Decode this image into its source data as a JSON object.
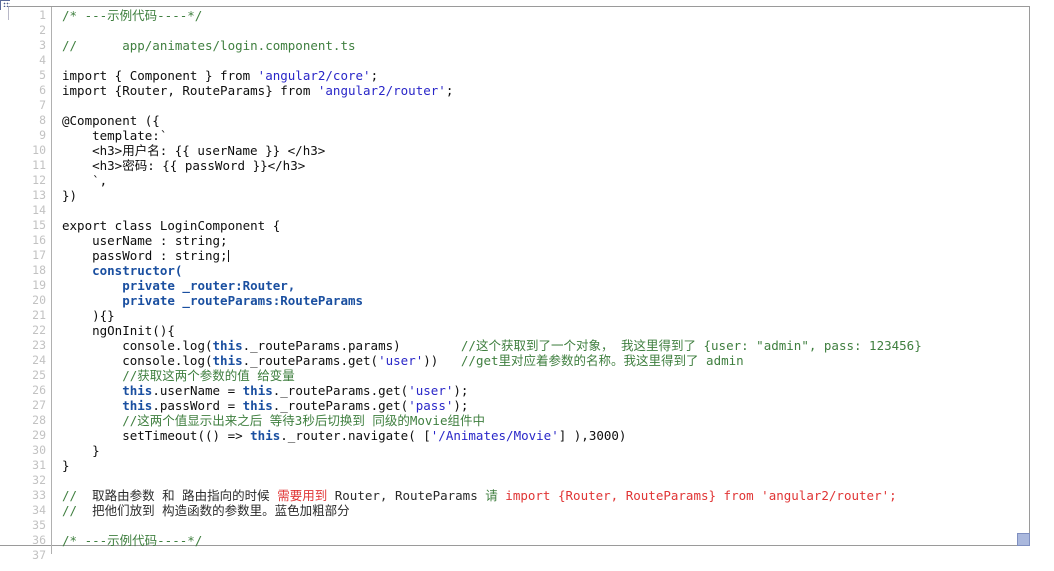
{
  "window": {
    "title": "Code editor",
    "total_lines": 37,
    "first_line": 1,
    "font_size_px": 12.5,
    "line_height_px": 15
  },
  "colors": {
    "background": "#ffffff",
    "gutter_text": "#c2c2c2",
    "gutter_separator": "#b0b0b0",
    "comment": "#3f7f3f",
    "string": "#2926c8",
    "keyword_bold": "#1a4fa0",
    "plain_code": "#0d0d0d",
    "emphasis_red": "#e03535",
    "frame_line": "#9a9a9a",
    "resize_handle": "#aab8dd"
  },
  "gutter": {
    "line_numbers": [
      1,
      2,
      3,
      4,
      5,
      6,
      7,
      8,
      9,
      10,
      11,
      12,
      13,
      14,
      15,
      16,
      17,
      18,
      19,
      20,
      21,
      22,
      23,
      24,
      25,
      26,
      27,
      28,
      29,
      30,
      31,
      32,
      33,
      34,
      35,
      36,
      37
    ]
  },
  "code": {
    "language": "TypeScript",
    "caret_line": 17,
    "caret_after_text": "passWord : string;",
    "lines": [
      {
        "n": 1,
        "text": "/* ---示例代码----*/",
        "tokens": [
          {
            "t": "/* ---示例代码----*/",
            "c": "cmt"
          }
        ]
      },
      {
        "n": 2,
        "text": "",
        "tokens": []
      },
      {
        "n": 3,
        "text": "//      app/animates/login.component.ts",
        "tokens": [
          {
            "t": "//      app/animates/login.component.ts",
            "c": "cmt"
          }
        ]
      },
      {
        "n": 4,
        "text": "",
        "tokens": []
      },
      {
        "n": 5,
        "text": "import { Component } from 'angular2/core';",
        "tokens": [
          {
            "t": "import { Component } from ",
            "c": "plain"
          },
          {
            "t": "'angular2/core'",
            "c": "str"
          },
          {
            "t": ";",
            "c": "plain"
          }
        ]
      },
      {
        "n": 6,
        "text": "import {Router, RouteParams} from 'angular2/router';",
        "tokens": [
          {
            "t": "import {Router, RouteParams} from ",
            "c": "plain"
          },
          {
            "t": "'angular2/router'",
            "c": "str"
          },
          {
            "t": ";",
            "c": "plain"
          }
        ]
      },
      {
        "n": 7,
        "text": "",
        "tokens": []
      },
      {
        "n": 8,
        "text": "@Component ({",
        "tokens": [
          {
            "t": "@Component ({",
            "c": "plain"
          }
        ]
      },
      {
        "n": 9,
        "text": "    template:`",
        "tokens": [
          {
            "t": "    template:`",
            "c": "plain"
          }
        ]
      },
      {
        "n": 10,
        "text": "    <h3>用户名: {{ userName }} </h3>",
        "tokens": [
          {
            "t": "    <h3>用户名: {{ userName }} </h3>",
            "c": "plain"
          }
        ]
      },
      {
        "n": 11,
        "text": "    <h3>密码: {{ passWord }}</h3>",
        "tokens": [
          {
            "t": "    <h3>密码: {{ passWord }}</h3>",
            "c": "plain"
          }
        ]
      },
      {
        "n": 12,
        "text": "    `,",
        "tokens": [
          {
            "t": "    `,",
            "c": "plain"
          }
        ]
      },
      {
        "n": 13,
        "text": "})",
        "tokens": [
          {
            "t": "})",
            "c": "plain"
          }
        ]
      },
      {
        "n": 14,
        "text": "",
        "tokens": []
      },
      {
        "n": 15,
        "text": "export class LoginComponent {",
        "tokens": [
          {
            "t": "export class LoginComponent {",
            "c": "plain"
          }
        ]
      },
      {
        "n": 16,
        "text": "    userName : string;",
        "tokens": [
          {
            "t": "    userName : string;",
            "c": "plain"
          }
        ]
      },
      {
        "n": 17,
        "text": "    passWord : string;",
        "tokens": [
          {
            "t": "    passWord : string;",
            "c": "plain"
          }
        ],
        "caret": true
      },
      {
        "n": 18,
        "text": "    constructor(",
        "tokens": [
          {
            "t": "    ",
            "c": "plain"
          },
          {
            "t": "constructor(",
            "c": "kw"
          }
        ]
      },
      {
        "n": 19,
        "text": "        private _router:Router,",
        "tokens": [
          {
            "t": "        ",
            "c": "plain"
          },
          {
            "t": "private _router:Router,",
            "c": "kw"
          }
        ]
      },
      {
        "n": 20,
        "text": "        private _routeParams:RouteParams",
        "tokens": [
          {
            "t": "        ",
            "c": "plain"
          },
          {
            "t": "private _routeParams:RouteParams",
            "c": "kw"
          }
        ]
      },
      {
        "n": 21,
        "text": "    ){}",
        "tokens": [
          {
            "t": "    ){}",
            "c": "plain"
          }
        ]
      },
      {
        "n": 22,
        "text": "    ngOnInit(){",
        "tokens": [
          {
            "t": "    ngOnInit(){",
            "c": "plain"
          }
        ]
      },
      {
        "n": 23,
        "text": "        console.log(this._routeParams.params)        //这个获取到了一个对象， 我这里得到了 {user: \"admin\", pass: 123456}",
        "tokens": [
          {
            "t": "        console.log(",
            "c": "plain"
          },
          {
            "t": "this",
            "c": "kw"
          },
          {
            "t": "._routeParams.params)",
            "c": "plain"
          },
          {
            "t": "        ",
            "c": "plain"
          },
          {
            "t": "//这个获取到了一个对象， 我这里得到了 {user: \"admin\", pass: 123456}",
            "c": "cmt"
          }
        ]
      },
      {
        "n": 24,
        "text": "        console.log(this._routeParams.get('user'))   //get里对应着参数的名称。我这里得到了 admin",
        "tokens": [
          {
            "t": "        console.log(",
            "c": "plain"
          },
          {
            "t": "this",
            "c": "kw"
          },
          {
            "t": "._routeParams.get(",
            "c": "plain"
          },
          {
            "t": "'user'",
            "c": "str"
          },
          {
            "t": "))",
            "c": "plain"
          },
          {
            "t": "   ",
            "c": "plain"
          },
          {
            "t": "//get里对应着参数的名称。我这里得到了 admin",
            "c": "cmt"
          }
        ]
      },
      {
        "n": 25,
        "text": "        //获取这两个参数的值 给变量",
        "tokens": [
          {
            "t": "        ",
            "c": "plain"
          },
          {
            "t": "//获取这两个参数的值 给变量",
            "c": "cmt"
          }
        ]
      },
      {
        "n": 26,
        "text": "        this.userName = this._routeParams.get('user');",
        "tokens": [
          {
            "t": "        ",
            "c": "plain"
          },
          {
            "t": "this",
            "c": "kw"
          },
          {
            "t": ".userName = ",
            "c": "plain"
          },
          {
            "t": "this",
            "c": "kw"
          },
          {
            "t": "._routeParams.get(",
            "c": "plain"
          },
          {
            "t": "'user'",
            "c": "str"
          },
          {
            "t": ");",
            "c": "plain"
          }
        ]
      },
      {
        "n": 27,
        "text": "        this.passWord = this._routeParams.get('pass');",
        "tokens": [
          {
            "t": "        ",
            "c": "plain"
          },
          {
            "t": "this",
            "c": "kw"
          },
          {
            "t": ".passWord = ",
            "c": "plain"
          },
          {
            "t": "this",
            "c": "kw"
          },
          {
            "t": "._routeParams.get(",
            "c": "plain"
          },
          {
            "t": "'pass'",
            "c": "str"
          },
          {
            "t": ");",
            "c": "plain"
          }
        ]
      },
      {
        "n": 28,
        "text": "        //这两个值显示出来之后 等待3秒后切换到 同级的Movie组件中",
        "tokens": [
          {
            "t": "        ",
            "c": "plain"
          },
          {
            "t": "//这两个值显示出来之后 等待3秒后切换到 同级的Movie组件中",
            "c": "cmt"
          }
        ]
      },
      {
        "n": 29,
        "text": "        setTimeout(() => this._router.navigate( ['/Animates/Movie'] ),3000)",
        "tokens": [
          {
            "t": "        setTimeout(() => ",
            "c": "plain"
          },
          {
            "t": "this",
            "c": "kw"
          },
          {
            "t": "._router.navigate( [",
            "c": "plain"
          },
          {
            "t": "'/Animates/Movie'",
            "c": "str"
          },
          {
            "t": "] ),3000)",
            "c": "plain"
          }
        ]
      },
      {
        "n": 30,
        "text": "    }",
        "tokens": [
          {
            "t": "    }",
            "c": "plain"
          }
        ]
      },
      {
        "n": 31,
        "text": "}",
        "tokens": [
          {
            "t": "}",
            "c": "plain"
          }
        ]
      },
      {
        "n": 32,
        "text": "",
        "tokens": []
      },
      {
        "n": 33,
        "text": "//  取路由参数 和 路由指向的时候 需要用到 Router, RouteParams 请 import {Router, RouteParams} from 'angular2/router';",
        "tokens": [
          {
            "t": "//",
            "c": "cmt"
          },
          {
            "t": "  取路由参数 和 路由指向的时候 ",
            "c": "dark"
          },
          {
            "t": "需要用到",
            "c": "red"
          },
          {
            "t": " Router, RouteParams ",
            "c": "dark"
          },
          {
            "t": "请",
            "c": "cmt"
          },
          {
            "t": " import {Router, RouteParams} from 'angular2/router';",
            "c": "red"
          }
        ]
      },
      {
        "n": 34,
        "text": "//  把他们放到 构造函数的参数里。蓝色加粗部分",
        "tokens": [
          {
            "t": "//",
            "c": "cmt"
          },
          {
            "t": "  把他们放到 构造函数的参数里。蓝色加粗部分",
            "c": "dark"
          }
        ]
      },
      {
        "n": 35,
        "text": "",
        "tokens": []
      },
      {
        "n": 36,
        "text": "/* ---示例代码----*/",
        "tokens": [
          {
            "t": "/* ---示例代码----*/",
            "c": "cmt"
          }
        ]
      },
      {
        "n": 37,
        "text": "",
        "tokens": []
      }
    ]
  }
}
